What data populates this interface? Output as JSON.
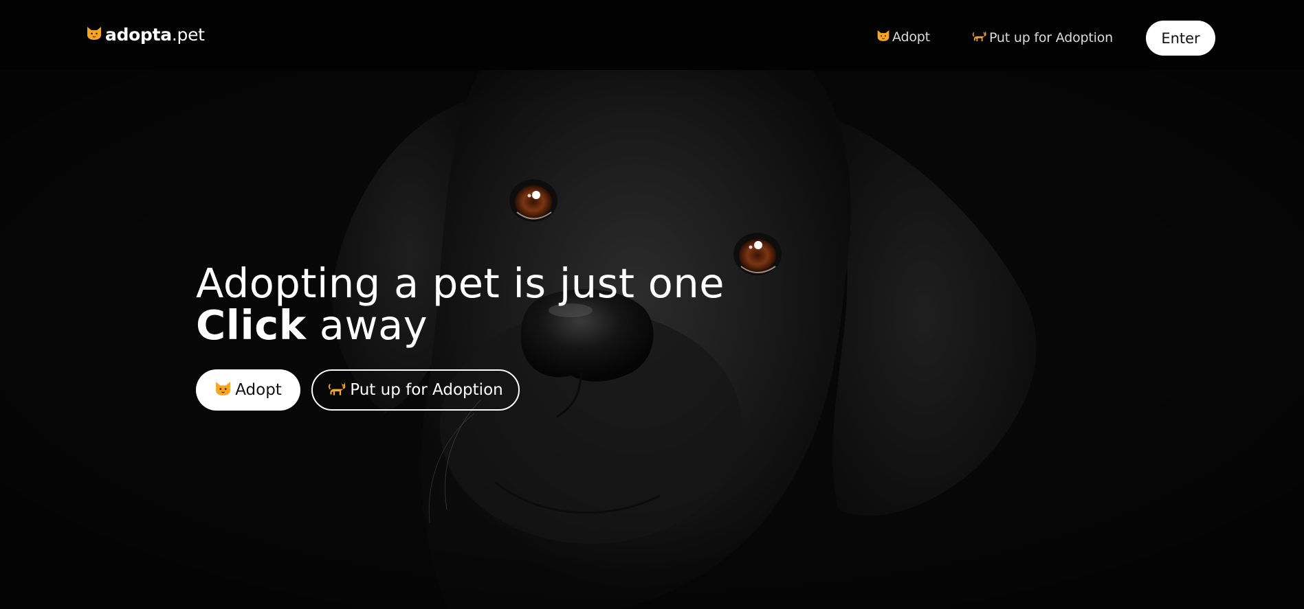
{
  "colors": {
    "background": "#000000",
    "text": "#ffffff",
    "nav_link": "#dcdcdc",
    "accent_orange": "#f5a623",
    "button_fill": "#ffffff"
  },
  "logo": {
    "icon": "cat-face-icon",
    "strong": "adopta",
    "light": ".pet"
  },
  "nav": {
    "adopt": {
      "icon": "cat-face-icon",
      "label": "Adopt"
    },
    "put_up": {
      "icon": "walking-cat-icon",
      "label": "Put up for Adoption"
    },
    "enter_label": "Enter"
  },
  "hero": {
    "headline_line1": "Adopting a pet is just one",
    "headline_bold": "Click",
    "headline_rest": " away",
    "background": "black-labrador-dog-photo",
    "adopt_button": {
      "icon": "cat-face-icon",
      "label": "Adopt"
    },
    "put_up_button": {
      "icon": "walking-cat-icon",
      "label": "Put up for Adoption"
    }
  }
}
